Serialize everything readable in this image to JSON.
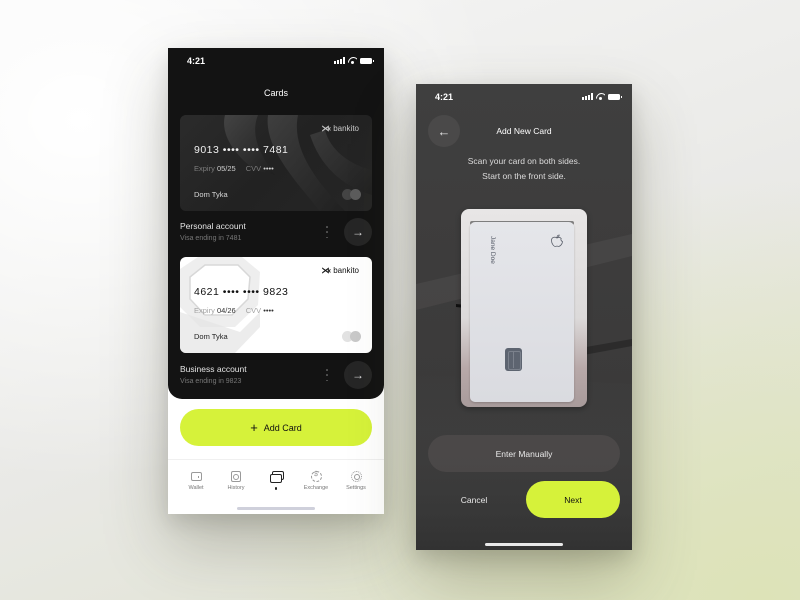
{
  "theme": {
    "accent": "#d6f23a",
    "dark_bg": "#131313",
    "card_dark": "#262626"
  },
  "screen1": {
    "status_time": "4:21",
    "title": "Cards",
    "cards": [
      {
        "brand": "bankito",
        "number": "9013 •••• •••• 7481",
        "expiry_label": "Expiry",
        "expiry": "05/25",
        "cvv_label": "CVV",
        "cvv": "••••",
        "holder": "Dom Tyka",
        "style": "dark"
      },
      {
        "brand": "bankito",
        "number": "4621 •••• •••• 9823",
        "expiry_label": "Expiry",
        "expiry": "04/26",
        "cvv_label": "CVV",
        "cvv": "••••",
        "holder": "Dom Tyka",
        "style": "light"
      }
    ],
    "accounts": [
      {
        "name": "Personal account",
        "subtitle": "Visa ending in 7481",
        "arrow_icon": "→"
      },
      {
        "name": "Business account",
        "subtitle": "Visa ending in 9823",
        "arrow_icon": "→"
      }
    ],
    "add_card": {
      "icon": "+",
      "label": "Add Card"
    },
    "tabs": [
      {
        "label": "Wallet",
        "icon": "wallet-icon"
      },
      {
        "label": "History",
        "icon": "history-icon"
      },
      {
        "label": "",
        "icon": "cards-icon",
        "active": true
      },
      {
        "label": "Exchange",
        "icon": "exchange-icon"
      },
      {
        "label": "Settings",
        "icon": "settings-icon"
      }
    ]
  },
  "screen2": {
    "status_time": "4:21",
    "back_icon": "←",
    "title": "Add New Card",
    "instruction_line1": "Scan your card on both sides.",
    "instruction_line2": "Start on the front side.",
    "scanned_card_holder": "Jane Doe",
    "enter_manually": "Enter Manually",
    "cancel": "Cancel",
    "next": "Next"
  }
}
